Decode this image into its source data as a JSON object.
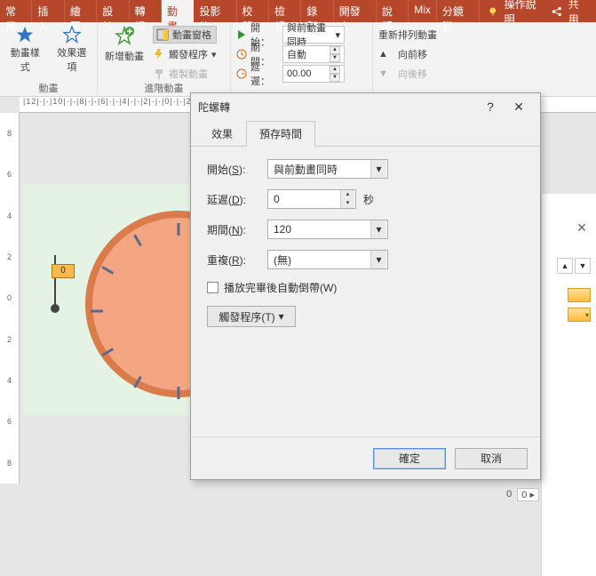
{
  "ribbon": {
    "tabs": [
      "常用",
      "插入",
      "繪圖",
      "設計",
      "轉場",
      "動畫",
      "投影片",
      "校閱",
      "檢視",
      "錄製",
      "開發人",
      "說明",
      "Mix",
      "分鏡腳"
    ],
    "active_index": 5,
    "help_hint": "操作說明",
    "share": "共用"
  },
  "groups": {
    "anim": {
      "label": "動畫",
      "style_btn": "動畫樣式",
      "options_btn": "效果選項"
    },
    "adv": {
      "label": "進階動畫",
      "add": "新增動畫",
      "pane": "動畫窗格",
      "trigger": "觸發程序",
      "copy": "複製動畫"
    },
    "timing": {
      "start_lbl": "開始：",
      "start_val": "與前動畫同時",
      "duration_lbl": "期間：",
      "duration_val": "自動",
      "delay_lbl": "延遲：",
      "delay_val": "00.00",
      "reorder": "重新排列動畫",
      "move_fwd": "向前移",
      "move_back": "向後移"
    }
  },
  "canvas": {
    "ruler_h": "|12|·|·|10|·|·|8|·|·|6|·|·|4|·|·|2|·|·|0|·|·|2|·|·|4|",
    "ruler_v": [
      "8",
      "6",
      "4",
      "2",
      "0",
      "2",
      "4",
      "6",
      "8"
    ],
    "zero_tag": "0"
  },
  "dialog": {
    "title": "陀螺轉",
    "tab_effect": "效果",
    "tab_timing": "預存時間",
    "start_lbl": "開始(",
    "start_key": "S",
    "close": "):",
    "start_val": "與前動畫同時",
    "delay_lbl": "延遲(",
    "delay_key": "D",
    "delay_val": "0",
    "delay_unit": "秒",
    "duration_lbl": "期間(",
    "duration_key": "N",
    "duration_val": "120",
    "repeat_lbl": "重複(",
    "repeat_key": "R",
    "repeat_val": "(無)",
    "rewind_lbl": "播放完畢後自動倒帶(",
    "rewind_key": "W",
    "rewind_close": ")",
    "trigger_btn": "觸發程序(",
    "trigger_key": "T",
    "trigger_close": ") ",
    "ok": "確定",
    "cancel": "取消"
  },
  "status": {
    "sec": "0",
    "counter": "0 ▸"
  }
}
